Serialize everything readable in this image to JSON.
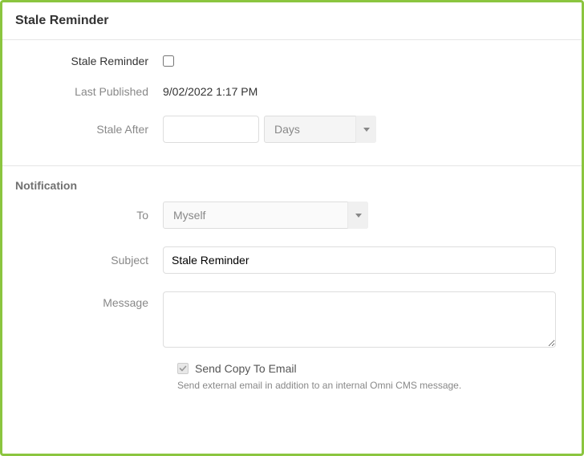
{
  "header": {
    "title": "Stale Reminder"
  },
  "staleSection": {
    "reminderLabel": "Stale Reminder",
    "reminderChecked": false,
    "lastPublishedLabel": "Last Published",
    "lastPublishedValue": "9/02/2022 1:17 PM",
    "staleAfterLabel": "Stale After",
    "staleAfterValue": "",
    "staleAfterUnit": "Days"
  },
  "notificationSection": {
    "heading": "Notification",
    "toLabel": "To",
    "toValue": "Myself",
    "subjectLabel": "Subject",
    "subjectValue": "Stale Reminder",
    "messageLabel": "Message",
    "messageValue": "",
    "sendCopyLabel": "Send Copy To Email",
    "sendCopyChecked": true,
    "sendCopyHelp": "Send external email in addition to an internal Omni CMS message."
  }
}
